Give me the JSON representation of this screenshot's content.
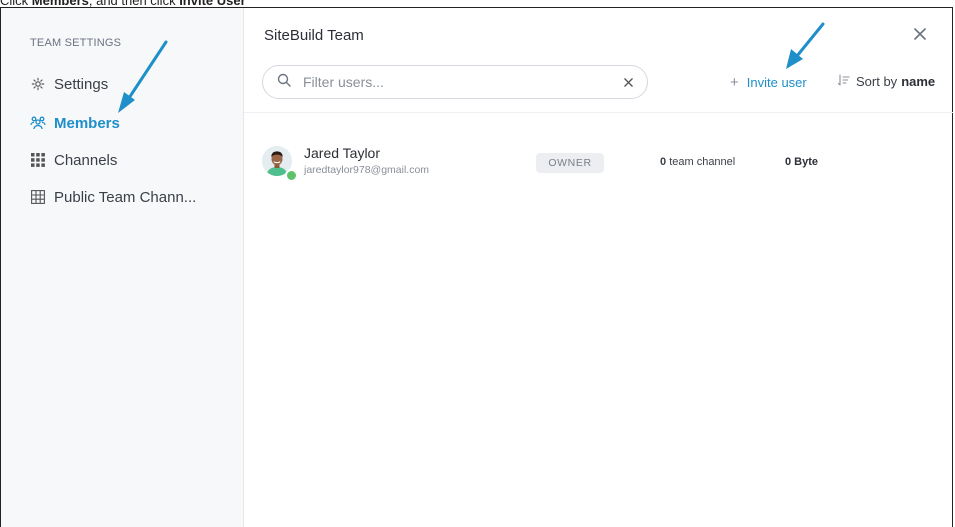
{
  "instruction": {
    "prefix": "Click ",
    "members_word": "Members",
    "middle": ", and then click ",
    "invite_word": "Invite User"
  },
  "sidebar": {
    "heading": "TEAM SETTINGS",
    "items": [
      {
        "label": "Settings",
        "icon": "gear-icon",
        "active": false
      },
      {
        "label": "Members",
        "icon": "users-icon",
        "active": true
      },
      {
        "label": "Channels",
        "icon": "grid-icon",
        "active": false
      },
      {
        "label": "Public Team Chann...",
        "icon": "table-icon",
        "active": false
      }
    ]
  },
  "header": {
    "title": "SiteBuild Team",
    "close_icon": "close-icon"
  },
  "search": {
    "placeholder": "Filter users...",
    "value": ""
  },
  "toolbar": {
    "invite_label": "Invite user",
    "sort_label": "Sort by",
    "sort_value": "name"
  },
  "members": [
    {
      "name": "Jared Taylor",
      "email": "jaredtaylor978@gmail.com",
      "role": "OWNER",
      "channels_count": "0",
      "channels_label": "team channel",
      "storage": "0 Byte"
    }
  ],
  "colors": {
    "accent": "#1f8fc9",
    "annotation_arrow": "#1f8fc9",
    "online": "#5ec26a"
  }
}
